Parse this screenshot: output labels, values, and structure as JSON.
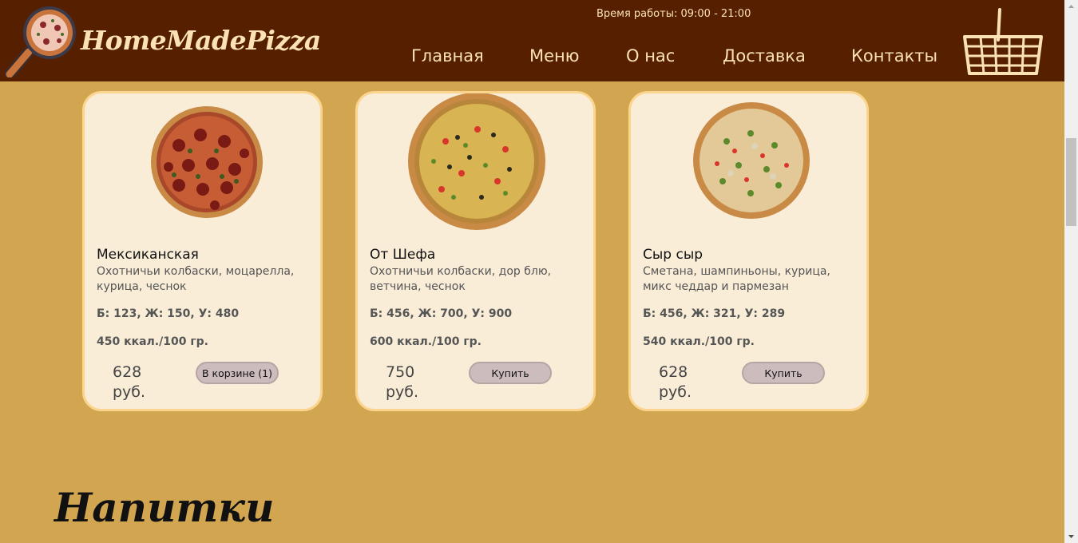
{
  "header": {
    "logo_text": "HomeMadePizza",
    "working_hours": "Время работы: 09:00 - 21:00",
    "nav": [
      {
        "label": "Главная"
      },
      {
        "label": "Меню"
      },
      {
        "label": "О нас"
      },
      {
        "label": "Доставка"
      },
      {
        "label": "Контакты"
      }
    ]
  },
  "products": [
    {
      "name": "Мексиканская",
      "description": "Охотничьи колбаски, моцарелла, курица, чеснок",
      "nutrition": "Б: 123, Ж: 150, У: 480",
      "calories": "450 ккал./100 гр.",
      "price": "628 руб.",
      "button_label": "В корзине (1)"
    },
    {
      "name": "От Шефа",
      "description": "Охотничьи колбаски, дор блю, ветчина, чеснок",
      "nutrition": "Б: 456, Ж: 700, У: 900",
      "calories": "600 ккал./100 гр.",
      "price": "750 руб.",
      "button_label": "Купить"
    },
    {
      "name": "Сыр сыр",
      "description": "Сметана, шампиньоны, курица, микс чеддар и пармезан",
      "nutrition": "Б: 456, Ж: 321, У: 289",
      "calories": "540 ккал./100 гр.",
      "price": "628 руб.",
      "button_label": "Купить"
    }
  ],
  "section_title": "Напитки",
  "colors": {
    "header_bg": "#561f00",
    "page_bg": "#d2a651",
    "card_bg": "#f9edd8",
    "card_border": "#fbd48e",
    "accent_text": "#fbe2b4",
    "button_bg": "#cdbcbd"
  }
}
